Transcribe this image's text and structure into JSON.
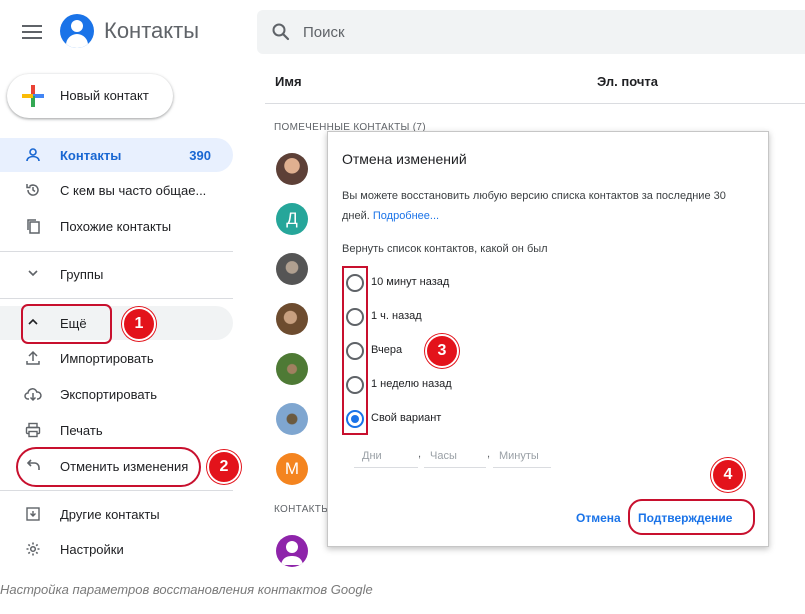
{
  "header": {
    "app_title": "Контакты",
    "search_placeholder": "Поиск",
    "brand_color": "#1a73e8"
  },
  "new_contact": {
    "label": "Новый контакт"
  },
  "sidebar": {
    "items": [
      {
        "label": "Контакты",
        "count": "390",
        "icon": "person-icon"
      },
      {
        "label": "С кем вы часто общае...",
        "icon": "history-icon"
      },
      {
        "label": "Похожие контакты",
        "icon": "copy-icon"
      },
      {
        "label": "Группы",
        "icon": "chevron-down-icon"
      },
      {
        "label": "Ещё",
        "icon": "chevron-up-icon"
      },
      {
        "label": "Импортировать",
        "icon": "upload-icon"
      },
      {
        "label": "Экспортировать",
        "icon": "cloud-download-icon"
      },
      {
        "label": "Печать",
        "icon": "printer-icon"
      },
      {
        "label": "Отменить изменения",
        "icon": "undo-icon"
      },
      {
        "label": "Другие контакты",
        "icon": "archive-icon"
      },
      {
        "label": "Настройки",
        "icon": "gear-icon"
      }
    ]
  },
  "table": {
    "col_name": "Имя",
    "col_email": "Эл. почта",
    "section_starred": "ПОМЕЧЕННЫЕ КОНТАКТЫ (7)",
    "section_contacts": "КОНТАКТЫ",
    "avatars": [
      {
        "kind": "photo",
        "color": "#8d6e63"
      },
      {
        "kind": "letter",
        "letter": "Д",
        "color": "#26a69a"
      },
      {
        "kind": "photo",
        "color": "#6d6d6d"
      },
      {
        "kind": "photo",
        "color": "#7b5a3c"
      },
      {
        "kind": "photo",
        "color": "#5b7f3a"
      },
      {
        "kind": "photo",
        "color": "#5c8ab8"
      },
      {
        "kind": "letter",
        "letter": "М",
        "color": "#f4841f"
      },
      {
        "kind": "person",
        "color": "#8e24aa"
      }
    ]
  },
  "dialog": {
    "title": "Отмена изменений",
    "text": "Вы можете восстановить любую версию списка контактов за последние 30 дней.",
    "link": "Подробнее...",
    "subtitle": "Вернуть список контактов, какой он был",
    "options": [
      {
        "label": "10 минут назад",
        "checked": false
      },
      {
        "label": "1 ч. назад",
        "checked": false
      },
      {
        "label": "Вчера",
        "checked": false
      },
      {
        "label": "1 неделю назад",
        "checked": false
      },
      {
        "label": "Свой вариант",
        "checked": true
      }
    ],
    "fields": {
      "days": "Дни",
      "hours": "Часы",
      "minutes": "Минуты"
    },
    "cancel": "Отмена",
    "confirm": "Подтверждение"
  },
  "annotations": {
    "badge1": "1",
    "badge2": "2",
    "badge3": "3",
    "badge4": "4",
    "color": "#e3131b"
  },
  "caption": "Настройка параметров восстановления контактов Google"
}
